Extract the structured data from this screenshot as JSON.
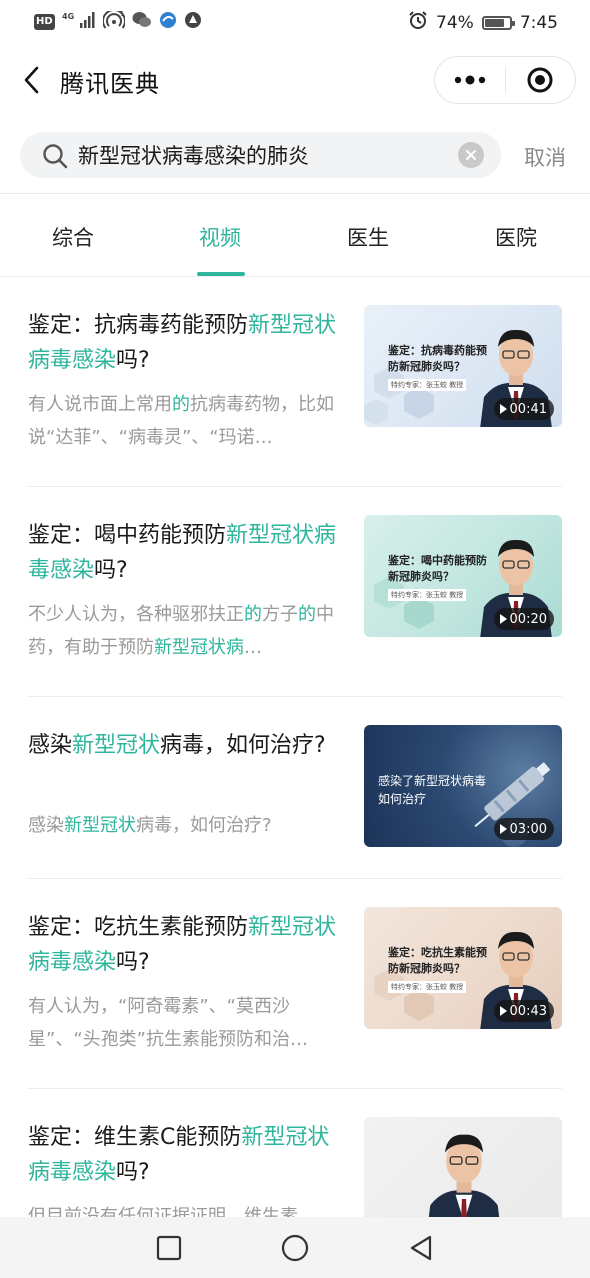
{
  "status_bar": {
    "hd": "HD",
    "network": "4G",
    "battery_percent": "74%",
    "battery_level": 0.74,
    "time": "7:45"
  },
  "nav": {
    "title": "腾讯医典",
    "back_icon": "chevron-left-icon",
    "more_icon": "more-dots-icon",
    "close_icon": "target-close-icon"
  },
  "search": {
    "value": "新型冠状病毒感染的肺炎",
    "cancel_label": "取消"
  },
  "tabs": [
    {
      "label": "综合",
      "active": false
    },
    {
      "label": "视频",
      "active": true
    },
    {
      "label": "医生",
      "active": false
    },
    {
      "label": "医院",
      "active": false
    }
  ],
  "colors": {
    "accent": "#2fb59c",
    "text": "#1a1a1a",
    "muted": "#9a9a9a"
  },
  "results": [
    {
      "title_parts": [
        "鉴定：抗病毒药能预防",
        "新型冠状病毒感染",
        "吗?"
      ],
      "desc_parts": [
        "有人说市面上常用",
        "的",
        "抗病毒药物，比如说“达菲”、“病毒灵”、“玛诺…"
      ],
      "thumb_caption_1": "鉴定：抗病毒药能预",
      "thumb_caption_2": "防新冠肺炎吗？",
      "thumb_sub": "特约专家：张玉蛟 教授",
      "duration": "00:41"
    },
    {
      "title_parts": [
        "鉴定：喝中药能预防",
        "新型冠状病毒感染",
        "吗?"
      ],
      "desc_parts": [
        "不少人认为，各种驱邪扶正",
        "的",
        "方子",
        "的",
        "中药，有助于预防",
        "新型冠状病",
        "…"
      ],
      "thumb_caption_1": "鉴定：喝中药能预防",
      "thumb_caption_2": "新冠肺炎吗？",
      "thumb_sub": "特约专家：张玉蛟 教授",
      "duration": "00:20"
    },
    {
      "title_parts": [
        "感染",
        "新型冠状",
        "病毒，如何治疗?"
      ],
      "desc_parts": [
        "感染",
        "新型冠状",
        "病毒，如何治疗?"
      ],
      "thumb_caption_1": "感染了新型冠状病毒",
      "thumb_caption_2": "如何治疗",
      "duration": "03:00"
    },
    {
      "title_parts": [
        "鉴定：吃抗生素能预防",
        "新型冠状病毒感染",
        "吗?"
      ],
      "desc_parts": [
        "有人认为，“阿奇霉素”、“莫西沙星”、“头孢类”抗生素能预防和治…"
      ],
      "thumb_caption_1": "鉴定：吃抗生素能预",
      "thumb_caption_2": "防新冠肺炎吗？",
      "thumb_sub": "特约专家：张玉蛟 教授",
      "duration": "00:43"
    },
    {
      "title_parts": [
        "鉴定：维生素C能预防",
        "新型冠状病毒感染",
        "吗?"
      ],
      "desc_parts": [
        "但目前没有任何证据证明，维生素…"
      ]
    }
  ],
  "system_nav": {
    "recents_icon": "square-recents-icon",
    "home_icon": "circle-home-icon",
    "back_icon": "triangle-back-icon"
  }
}
